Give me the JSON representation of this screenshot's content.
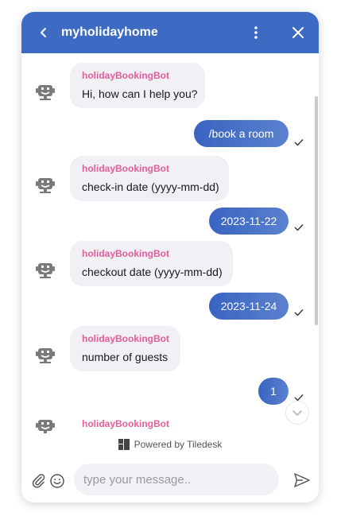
{
  "header": {
    "title": "myholidayhome",
    "background": "#3d6bc4"
  },
  "conversation": {
    "bot_name": "holidayBookingBot",
    "messages": [
      {
        "from": "bot",
        "text": "Hi, how can I help you?"
      },
      {
        "from": "user",
        "text": "/book a room",
        "status": "sent"
      },
      {
        "from": "bot",
        "text": "check-in date (yyyy-mm-dd)"
      },
      {
        "from": "user",
        "text": "2023-11-22",
        "status": "sent"
      },
      {
        "from": "bot",
        "text": "checkout date (yyyy-mm-dd)"
      },
      {
        "from": "user",
        "text": "2023-11-24",
        "status": "sent"
      },
      {
        "from": "bot",
        "text": "number of guests"
      },
      {
        "from": "user",
        "text": "1",
        "status": "sent"
      }
    ],
    "partial_bot_name": "holidayBookingBot"
  },
  "footer": {
    "powered_by": "Powered by Tiledesk",
    "input_placeholder": "type your message.."
  },
  "colors": {
    "accent": "#3d6bc4",
    "bot_name": "#e05e9a",
    "bot_bubble": "#f0f0f5"
  }
}
